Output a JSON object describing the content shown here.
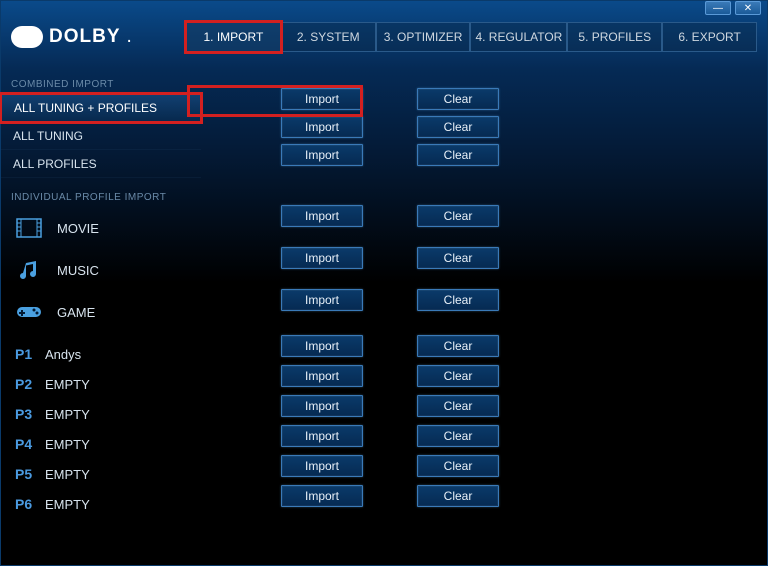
{
  "brand": "DOLBY",
  "titlebar": {
    "minimize": "—",
    "close": "✕"
  },
  "tabs": [
    {
      "label": "1. IMPORT",
      "active": true,
      "highlighted": true
    },
    {
      "label": "2. SYSTEM"
    },
    {
      "label": "3. OPTIMIZER"
    },
    {
      "label": "4. REGULATOR"
    },
    {
      "label": "5. PROFILES"
    },
    {
      "label": "6. EXPORT"
    }
  ],
  "sections": {
    "combined": {
      "title": "COMBINED IMPORT",
      "items": [
        {
          "label": "ALL TUNING + PROFILES",
          "selected": true,
          "highlighted": true
        },
        {
          "label": "ALL TUNING"
        },
        {
          "label": "ALL PROFILES"
        }
      ]
    },
    "individual": {
      "title": "INDIVIDUAL PROFILE IMPORT",
      "builtin": [
        {
          "label": "MOVIE",
          "icon": "film"
        },
        {
          "label": "MUSIC",
          "icon": "music"
        },
        {
          "label": "GAME",
          "icon": "gamepad"
        }
      ],
      "custom": [
        {
          "slot": "P1",
          "label": "Andys"
        },
        {
          "slot": "P2",
          "label": "EMPTY"
        },
        {
          "slot": "P3",
          "label": "EMPTY"
        },
        {
          "slot": "P4",
          "label": "EMPTY"
        },
        {
          "slot": "P5",
          "label": "EMPTY"
        },
        {
          "slot": "P6",
          "label": "EMPTY"
        }
      ]
    }
  },
  "buttons": {
    "import": "Import",
    "clear": "Clear"
  }
}
